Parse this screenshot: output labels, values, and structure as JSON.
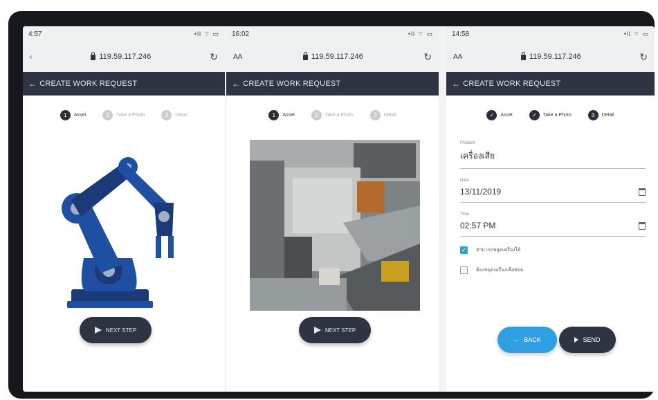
{
  "screens": [
    {
      "time": "4:57",
      "signal": "•ll ⌔ ▭",
      "url": "119.59.117.246",
      "title": "CREATE WORK REQUEST",
      "steps": [
        {
          "num": "1",
          "label": "Asset",
          "state": "active"
        },
        {
          "num": "2",
          "label": "Take a Photo",
          "state": "pending"
        },
        {
          "num": "3",
          "label": "Detail",
          "state": "pending"
        }
      ],
      "button_label": "NEXT STEP"
    },
    {
      "time": "16:02",
      "aa": "AA",
      "url": "119.59.117.246",
      "signal": "•ll ⌔ ▭",
      "title": "CREATE WORK REQUEST",
      "steps": [
        {
          "num": "1",
          "label": "Asset",
          "state": "active"
        },
        {
          "num": "2",
          "label": "Take a Photo",
          "state": "pending"
        },
        {
          "num": "3",
          "label": "Detail",
          "state": "pending"
        }
      ],
      "button_label": "NEXT STEP"
    },
    {
      "time": "14:58",
      "aa": "AA",
      "url": "119.59.117.246",
      "signal": "•ll ⌔ ▭",
      "title": "CREATE WORK REQUEST",
      "steps": [
        {
          "num": "✓",
          "label": "Asset",
          "state": "done"
        },
        {
          "num": "✓",
          "label": "Take a Photo",
          "state": "done"
        },
        {
          "num": "3",
          "label": "Detail",
          "state": "active"
        }
      ],
      "form": {
        "problem_label": "Problem",
        "problem_value": "เครื่องเสีย",
        "date_label": "Date",
        "date_value": "13/11/2019",
        "time_label": "Time",
        "time_value": "02:57 PM",
        "check1_label": "สามารถหยุดเครื่องได้",
        "check2_label": "ต้องหยุดเครื่องเพื่อซ่อม"
      },
      "back_label": "BACK",
      "send_label": "SEND"
    }
  ],
  "colors": {
    "appbar": "#2d3442",
    "accent_blue": "#2e9fe0",
    "robot_blue": "#1e4fa3",
    "robot_dark": "#1a3a78",
    "checkbox": "#2aa6c9"
  }
}
